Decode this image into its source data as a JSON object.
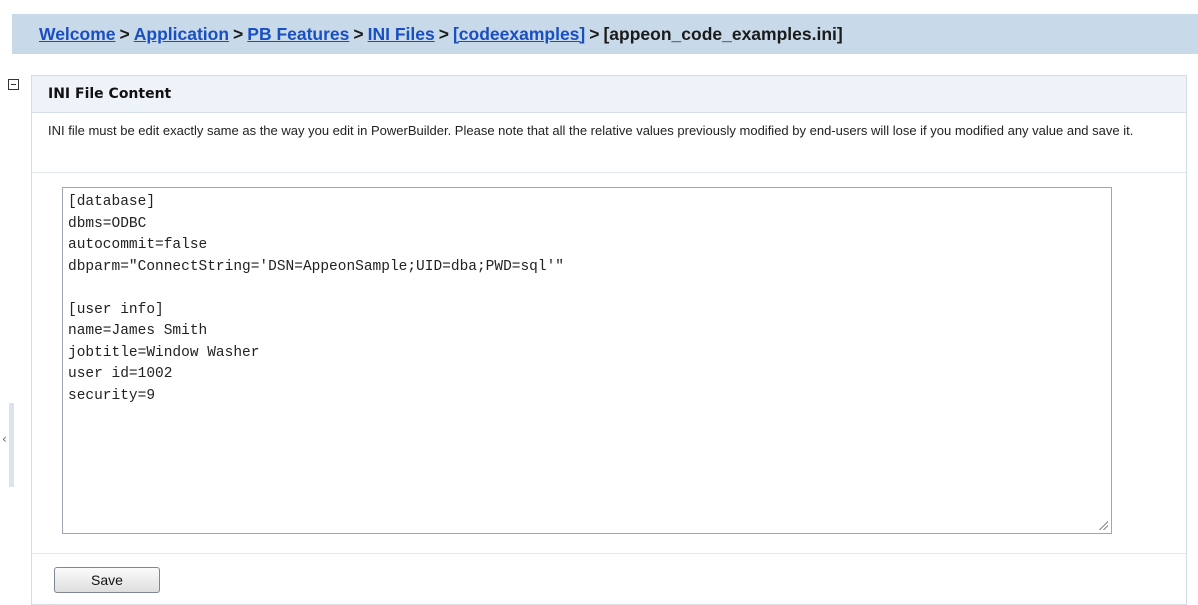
{
  "breadcrumb": {
    "items": [
      "Welcome",
      "Application",
      "PB Features ",
      "INI Files",
      "[codeexamples]"
    ],
    "separator": ">",
    "current": "[appeon_code_examples.ini]"
  },
  "panel": {
    "title": "INI File Content",
    "description": "INI file must be edit exactly same as the way you edit in PowerBuilder. Please note that all the relative values previously modified by end-users will lose if you modified any value and save it.",
    "ini_content": "[database]\ndbms=ODBC\nautocommit=false\ndbparm=\"ConnectString='DSN=AppeonSample;UID=dba;PWD=sql'\"\n\n[user info]\nname=James Smith\njobtitle=Window Washer\nuser id=1002\nsecurity=9",
    "save_label": "Save"
  },
  "side_tab": {
    "arrow": "‹"
  },
  "colors": {
    "breadcrumb_bg": "#c8d9ea",
    "link": "#1a4fc0",
    "panel_header_bg": "#eef3fa",
    "panel_border": "#d5dde6"
  }
}
